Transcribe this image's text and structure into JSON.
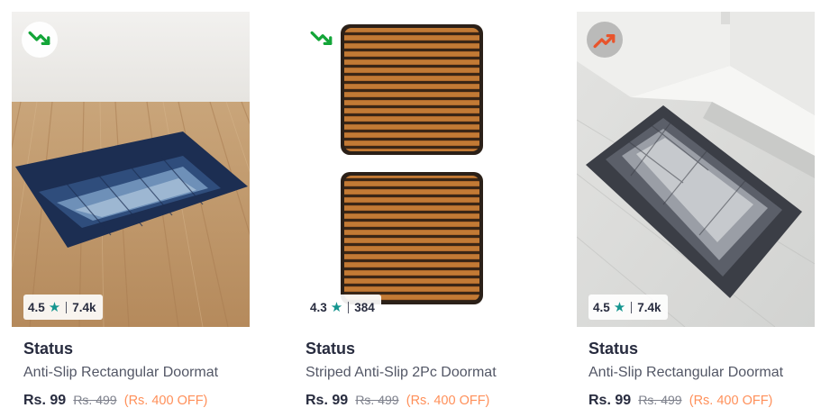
{
  "colors": {
    "trend_down": "#13a538",
    "trend_up": "#e8542c",
    "star": "#14958f",
    "discount": "#ff905a",
    "text_primary": "#282c3f",
    "text_secondary": "#535766"
  },
  "products": [
    {
      "trend_icon": "trend-down-icon",
      "rating": "4.5",
      "rating_count": "7.4k",
      "brand": "Status",
      "title": "Anti-Slip Rectangular Doormat",
      "price": "Rs. 99",
      "mrp": "Rs. 499",
      "discount": "(Rs. 400 OFF)"
    },
    {
      "trend_icon": "trend-down-icon",
      "rating": "4.3",
      "rating_count": "384",
      "brand": "Status",
      "title": "Striped Anti-Slip 2Pc Doormat",
      "price": "Rs. 99",
      "mrp": "Rs. 499",
      "discount": "(Rs. 400 OFF)"
    },
    {
      "trend_icon": "trend-up-icon",
      "rating": "4.5",
      "rating_count": "7.4k",
      "brand": "Status",
      "title": "Anti-Slip Rectangular Doormat",
      "price": "Rs. 99",
      "mrp": "Rs. 499",
      "discount": "(Rs. 400 OFF)"
    }
  ]
}
